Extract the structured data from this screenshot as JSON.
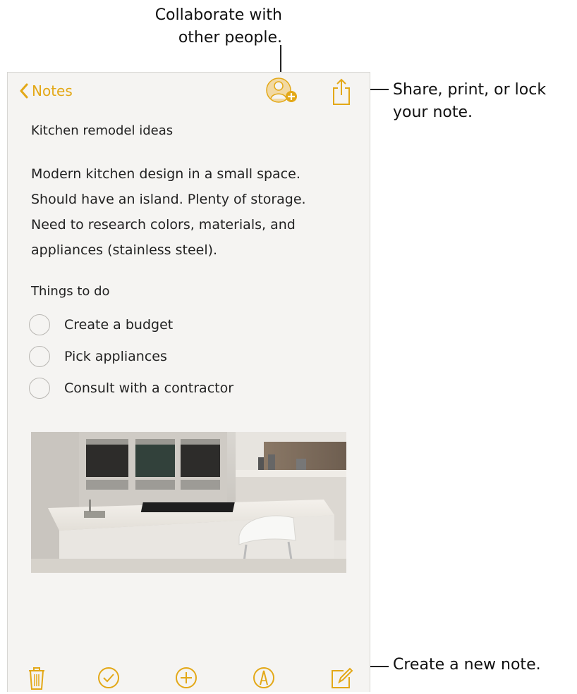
{
  "callouts": {
    "collaborate": "Collaborate with\nother people.",
    "share": "Share, print, or lock\nyour note.",
    "new_note": "Create a new note."
  },
  "nav": {
    "back_label": "Notes",
    "icons": [
      "chevron-left-icon",
      "add-people-icon",
      "share-icon"
    ]
  },
  "note": {
    "title": "Kitchen remodel ideas",
    "body": "Modern kitchen design in a small space.\nShould have an island. Plenty of storage.\nNeed to research colors, materials, and\nappliances (stainless steel).",
    "todo_heading": "Things to do",
    "checklist": [
      {
        "label": "Create a budget",
        "checked": false
      },
      {
        "label": "Pick appliances",
        "checked": false
      },
      {
        "label": "Consult with a contractor",
        "checked": false
      }
    ],
    "image_subject": "kitchen-island-photo"
  },
  "toolbar": {
    "icons": [
      "trash-icon",
      "checklist-icon",
      "add-icon",
      "markup-icon",
      "compose-icon"
    ]
  },
  "colors": {
    "accent": "#e3a817",
    "background": "#f5f4f2"
  }
}
